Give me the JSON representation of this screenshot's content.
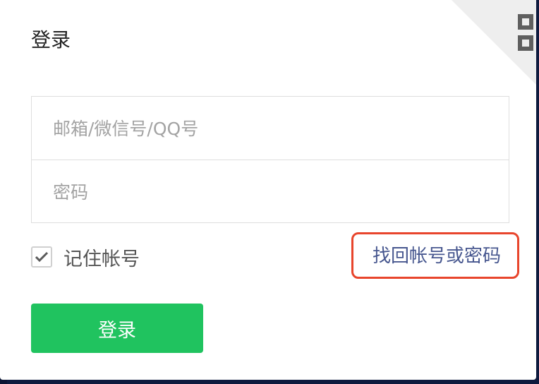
{
  "dialog": {
    "title": "登录"
  },
  "form": {
    "account_placeholder": "邮箱/微信号/QQ号",
    "password_placeholder": "密码",
    "remember_label": "记住帐号",
    "remember_checked": true,
    "recover_link": "找回帐号或密码",
    "submit_label": "登录"
  },
  "icons": {
    "corner": "qr-code-icon",
    "checkbox": "checkmark-icon"
  },
  "colors": {
    "primary_button": "#20c35f",
    "link": "#47578f",
    "highlight_border": "#e8452c"
  }
}
